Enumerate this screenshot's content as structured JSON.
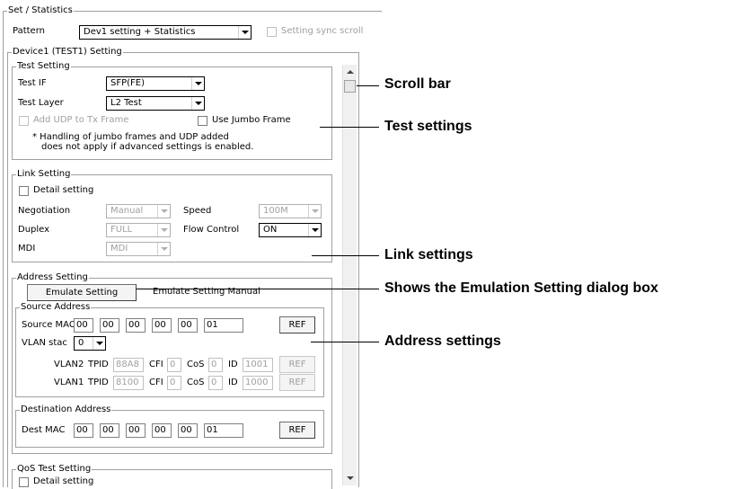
{
  "set_statistics": {
    "title": "Set / Statistics",
    "pattern_label": "Pattern",
    "pattern_value": "Dev1 setting + Statistics",
    "sync_scroll_label": "Setting sync scroll"
  },
  "device": {
    "title": "Device1 (TEST1) Setting"
  },
  "test_setting": {
    "title": "Test Setting",
    "test_if_label": "Test IF",
    "test_if_value": "SFP(FE)",
    "test_layer_label": "Test Layer",
    "test_layer_value": "L2 Test",
    "add_udp_label": "Add UDP to Tx Frame",
    "jumbo_label": "Use Jumbo Frame",
    "note_line1": "* Handling of jumbo frames and UDP added",
    "note_line2": "does not apply if advanced settings is enabled."
  },
  "link_setting": {
    "title": "Link Setting",
    "detail_label": "Detail setting",
    "negotiation_label": "Negotiation",
    "negotiation_value": "Manual",
    "speed_label": "Speed",
    "speed_value": "100M",
    "duplex_label": "Duplex",
    "duplex_value": "FULL",
    "flow_label": "Flow Control",
    "flow_value": "ON",
    "mdi_label": "MDI",
    "mdi_value": "MDI"
  },
  "address_setting": {
    "title": "Address Setting",
    "emulate_button": "Emulate Setting",
    "emulate_status": "Emulate Setting Manual",
    "source_title": "Source Address",
    "source_mac_label": "Source MAC",
    "source_mac": [
      "00",
      "00",
      "00",
      "00",
      "00",
      "01"
    ],
    "ref_label": "REF",
    "vlan_stack_label": "VLAN stac",
    "vlan_stack_value": "0",
    "vlan2": {
      "name": "VLAN2",
      "tpid_label": "TPID",
      "tpid": "88A8",
      "cfi_label": "CFI",
      "cfi": "0",
      "cos_label": "CoS",
      "cos": "0",
      "id_label": "ID",
      "id": "1001"
    },
    "vlan1": {
      "name": "VLAN1",
      "tpid_label": "TPID",
      "tpid": "8100",
      "cfi_label": "CFI",
      "cfi": "0",
      "cos_label": "CoS",
      "cos": "0",
      "id_label": "ID",
      "id": "1000"
    },
    "dest_title": "Destination Address",
    "dest_mac_label": "Dest MAC",
    "dest_mac": [
      "00",
      "00",
      "00",
      "00",
      "00",
      "01"
    ]
  },
  "qos_setting": {
    "title": "QoS Test Setting",
    "detail_label": "Detail setting"
  },
  "callouts": {
    "scroll_bar": "Scroll bar",
    "test_settings": "Test settings",
    "link_settings": "Link settings",
    "emulation": "Shows the Emulation Setting dialog box",
    "address_settings": "Address settings"
  }
}
